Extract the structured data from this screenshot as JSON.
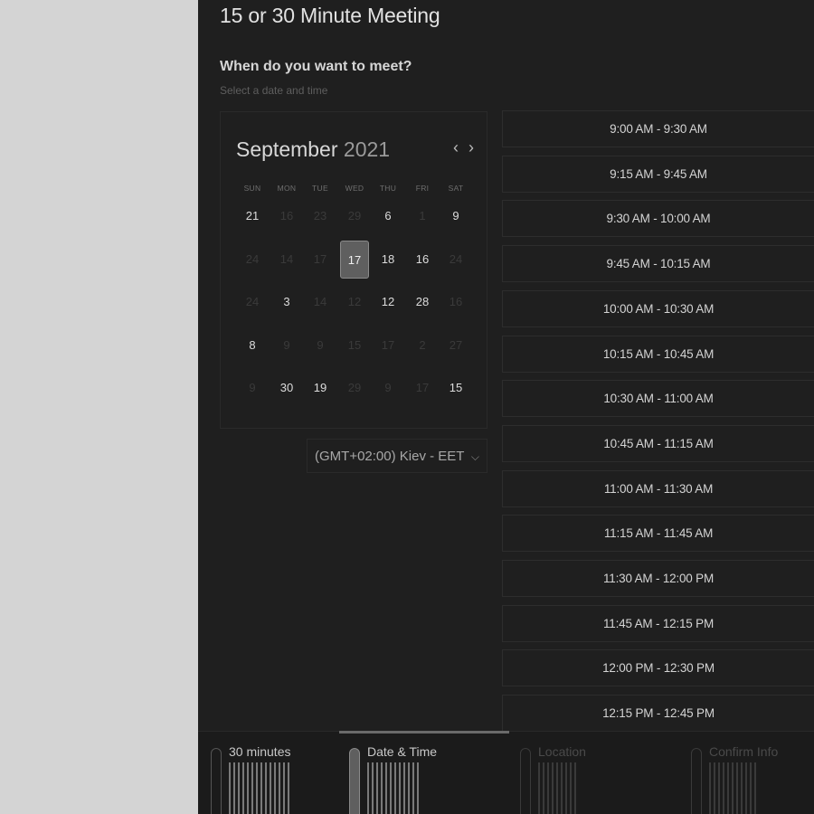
{
  "page": {
    "title": "15 or 30 Minute Meeting",
    "question": "When do you want to meet?",
    "subtitle": "Select a date and time"
  },
  "calendar": {
    "month": "September",
    "year": "2021",
    "prev_label": "‹",
    "next_label": "›",
    "weekdays": [
      "SUN",
      "MON",
      "TUE",
      "WED",
      "THU",
      "FRI",
      "SAT"
    ],
    "weeks": [
      [
        {
          "d": "21",
          "s": "on"
        },
        {
          "d": "16",
          "s": "off"
        },
        {
          "d": "23",
          "s": "off"
        },
        {
          "d": "29",
          "s": "off"
        },
        {
          "d": "6",
          "s": "on"
        },
        {
          "d": "1",
          "s": "off"
        },
        {
          "d": "9",
          "s": "on"
        }
      ],
      [
        {
          "d": "24",
          "s": "off"
        },
        {
          "d": "14",
          "s": "off"
        },
        {
          "d": "17",
          "s": "off"
        },
        {
          "d": "17",
          "s": "sel"
        },
        {
          "d": "18",
          "s": "on"
        },
        {
          "d": "16",
          "s": "on"
        },
        {
          "d": "24",
          "s": "off"
        }
      ],
      [
        {
          "d": "24",
          "s": "off"
        },
        {
          "d": "3",
          "s": "on"
        },
        {
          "d": "14",
          "s": "off"
        },
        {
          "d": "12",
          "s": "off"
        },
        {
          "d": "12",
          "s": "on"
        },
        {
          "d": "28",
          "s": "on"
        },
        {
          "d": "16",
          "s": "off"
        }
      ],
      [
        {
          "d": "8",
          "s": "on"
        },
        {
          "d": "9",
          "s": "off"
        },
        {
          "d": "9",
          "s": "off"
        },
        {
          "d": "15",
          "s": "off"
        },
        {
          "d": "17",
          "s": "off"
        },
        {
          "d": "2",
          "s": "off"
        },
        {
          "d": "27",
          "s": "off"
        }
      ],
      [
        {
          "d": "9",
          "s": "off"
        },
        {
          "d": "30",
          "s": "on"
        },
        {
          "d": "19",
          "s": "on"
        },
        {
          "d": "29",
          "s": "off"
        },
        {
          "d": "9",
          "s": "off"
        },
        {
          "d": "17",
          "s": "off"
        },
        {
          "d": "15",
          "s": "on"
        }
      ]
    ]
  },
  "timezone": {
    "value": "(GMT+02:00) Kiev - EET",
    "chevron": "⌵"
  },
  "slots": [
    "9:00 AM - 9:30 AM",
    "9:15 AM - 9:45 AM",
    "9:30 AM - 10:00 AM",
    "9:45 AM - 10:15 AM",
    "10:00 AM - 10:30 AM",
    "10:15 AM - 10:45 AM",
    "10:30 AM - 11:00 AM",
    "10:45 AM - 11:15 AM",
    "11:00 AM - 11:30 AM",
    "11:15 AM - 11:45 AM",
    "11:30 AM - 12:00 PM",
    "11:45 AM - 12:15 PM",
    "12:00 PM - 12:30 PM",
    "12:15 PM - 12:45 PM"
  ],
  "steps": [
    {
      "label": "30 minutes",
      "state": "done"
    },
    {
      "label": "Date & Time",
      "state": "active"
    },
    {
      "label": "Location",
      "state": "pending"
    },
    {
      "label": "Confirm Info",
      "state": "pending"
    }
  ]
}
